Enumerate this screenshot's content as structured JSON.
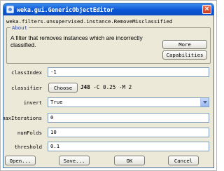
{
  "window": {
    "title": "weka.gui.GenericObjectEditor",
    "close_glyph": "×"
  },
  "object_path": "weka.filters.unsupervised.instance.RemoveMisclassified",
  "about": {
    "legend": "About",
    "description": "A filter that removes instances which are incorrectly classified.",
    "more_label": "More",
    "capabilities_label": "Capabilities"
  },
  "properties": {
    "classIndex": {
      "label": "classIndex",
      "value": "-1"
    },
    "classifier": {
      "label": "classifier",
      "button_label": "Choose",
      "name": "J48",
      "options": "-C 0.25 -M 2"
    },
    "invert": {
      "label": "invert",
      "value": "True"
    },
    "maxIterations": {
      "label": "maxIterations",
      "value": "0"
    },
    "numFolds": {
      "label": "numFolds",
      "value": "10"
    },
    "threshold": {
      "label": "threshold",
      "value": "0.1"
    }
  },
  "footer": {
    "open_label": "Open...",
    "save_label": "Save...",
    "ok_label": "OK",
    "cancel_label": "Cancel"
  }
}
